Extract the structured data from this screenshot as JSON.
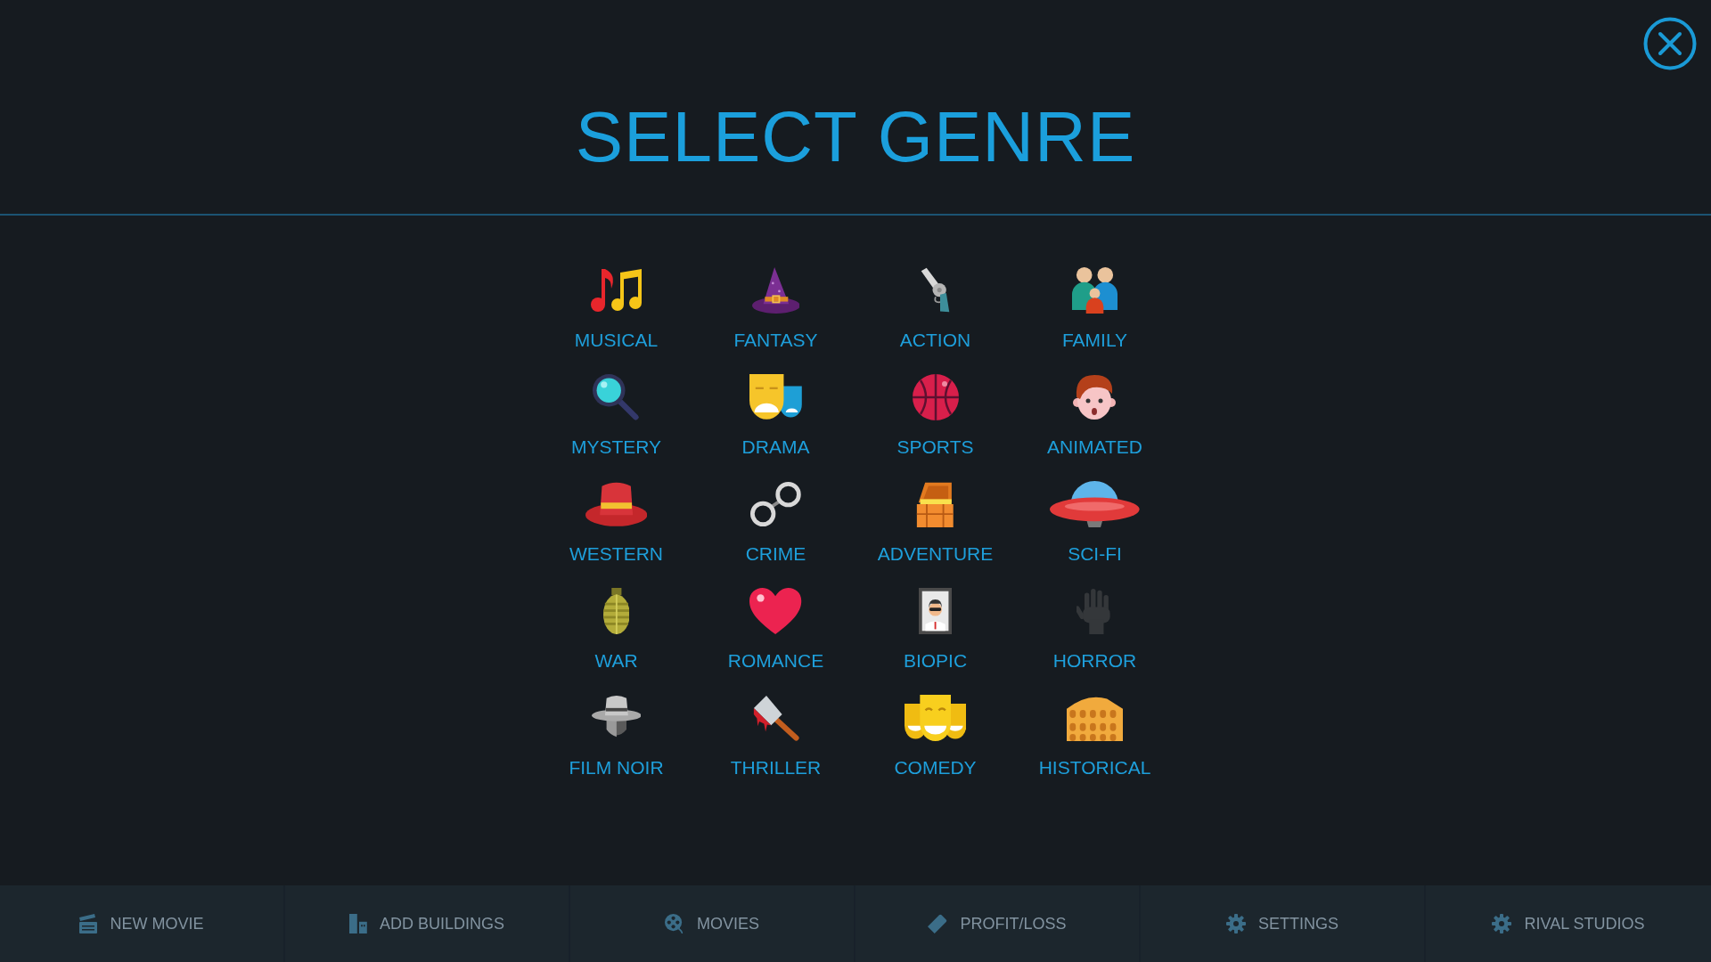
{
  "title": "SELECT GENRE",
  "genres": [
    {
      "label": "MUSICAL",
      "kind": "notes"
    },
    {
      "label": "FANTASY",
      "kind": "witchhat"
    },
    {
      "label": "ACTION",
      "kind": "revolver"
    },
    {
      "label": "FAMILY",
      "kind": "family"
    },
    {
      "label": "MYSTERY",
      "kind": "magnifier"
    },
    {
      "label": "DRAMA",
      "kind": "sadmasks"
    },
    {
      "label": "SPORTS",
      "kind": "ball"
    },
    {
      "label": "ANIMATED",
      "kind": "cartoon"
    },
    {
      "label": "WESTERN",
      "kind": "cowboyhat"
    },
    {
      "label": "CRIME",
      "kind": "handcuffs"
    },
    {
      "label": "ADVENTURE",
      "kind": "chest"
    },
    {
      "label": "SCI-FI",
      "kind": "saucer"
    },
    {
      "label": "WAR",
      "kind": "grenade"
    },
    {
      "label": "ROMANCE",
      "kind": "heart"
    },
    {
      "label": "BIOPIC",
      "kind": "portrait"
    },
    {
      "label": "HORROR",
      "kind": "hand"
    },
    {
      "label": "FILM NOIR",
      "kind": "fedora"
    },
    {
      "label": "THRILLER",
      "kind": "cleaver"
    },
    {
      "label": "COMEDY",
      "kind": "happymasks"
    },
    {
      "label": "HISTORICAL",
      "kind": "colosseum"
    }
  ],
  "bottom_nav": [
    {
      "label": "NEW MOVIE",
      "kind": "clapper"
    },
    {
      "label": "ADD BUILDINGS",
      "kind": "buildings"
    },
    {
      "label": "MOVIES",
      "kind": "reel"
    },
    {
      "label": "PROFIT/LOSS",
      "kind": "ticket"
    },
    {
      "label": "SETTINGS",
      "kind": "gear"
    },
    {
      "label": "RIVAL STUDIOS",
      "kind": "gear"
    }
  ]
}
